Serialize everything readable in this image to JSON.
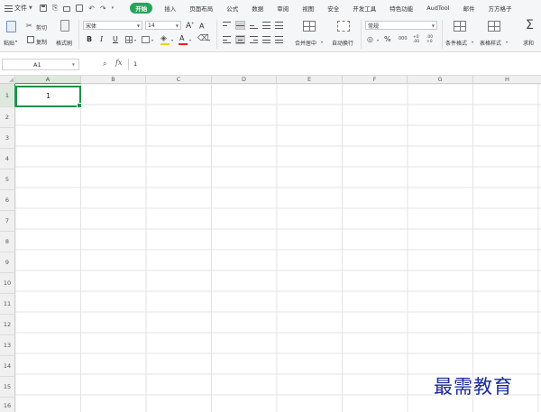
{
  "menu": {
    "file_label": "文件",
    "tabs": [
      {
        "label": "开始",
        "active": true
      },
      {
        "label": "插入"
      },
      {
        "label": "页面布局"
      },
      {
        "label": "公式"
      },
      {
        "label": "数据"
      },
      {
        "label": "审阅"
      },
      {
        "label": "视图"
      },
      {
        "label": "安全"
      },
      {
        "label": "开发工具"
      },
      {
        "label": "特色功能"
      },
      {
        "label": "AudTool"
      },
      {
        "label": "邮件"
      },
      {
        "label": "方方格子"
      }
    ]
  },
  "ribbon": {
    "paste_label": "粘贴",
    "cut_label": "剪切",
    "copy_label": "复制",
    "format_painter_label": "格式刷",
    "font_name": "宋体",
    "font_size": "14",
    "grow_font": "A",
    "shrink_font": "A",
    "bold": "B",
    "italic": "I",
    "underline": "U",
    "font_color_letter": "A",
    "merge_label": "合并居中",
    "wrap_label": "自动换行",
    "number_format": "常规",
    "percent": "%",
    "thousands": "000",
    "inc_decimal": "+0 .00",
    "dec_decimal": ".00 +0",
    "conditional_format_label": "条件格式",
    "table_style_label": "表格样式",
    "sum_label": "求和",
    "sigma": "Σ"
  },
  "formula_bar": {
    "name_box": "A1",
    "fx": "fx",
    "value": "1"
  },
  "grid": {
    "columns": [
      "A",
      "B",
      "C",
      "D",
      "E",
      "F",
      "G",
      "H"
    ],
    "rows": [
      "1",
      "2",
      "3",
      "4",
      "5",
      "6",
      "7",
      "8",
      "9",
      "10",
      "11",
      "12",
      "13",
      "14",
      "15",
      "16"
    ],
    "active_cell_value": "1"
  },
  "watermark": "最需教育",
  "colors": {
    "accent": "#25a55a",
    "active_cell_border": "#1f8f47",
    "watermark": "#1a2a9a"
  }
}
